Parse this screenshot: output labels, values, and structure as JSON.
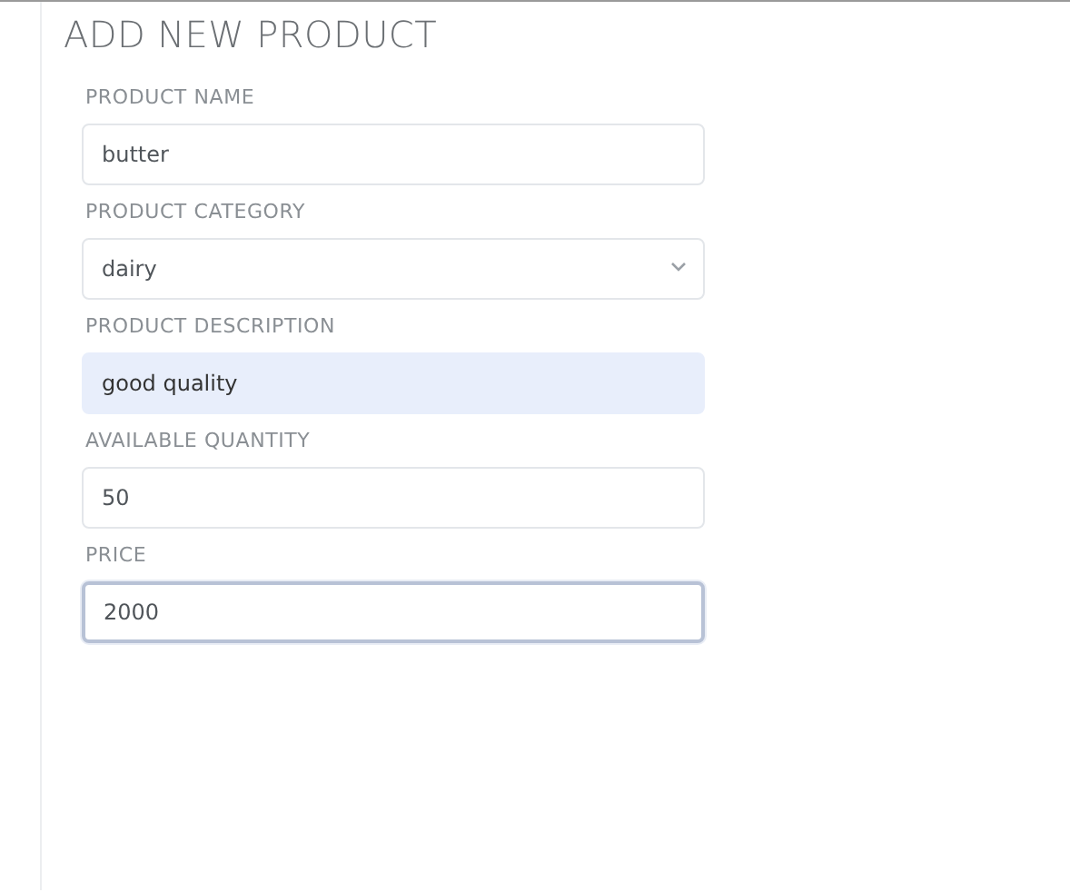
{
  "form": {
    "title": "ADD NEW PRODUCT",
    "fields": [
      {
        "label": "PRODUCT NAME",
        "kind": "text",
        "value": "butter",
        "autofilled": false,
        "focused": false
      },
      {
        "label": "PRODUCT CATEGORY",
        "kind": "select",
        "value": "dairy",
        "autofilled": false,
        "focused": false
      },
      {
        "label": "PRODUCT DESCRIPTION",
        "kind": "text",
        "value": "good quality",
        "autofilled": true,
        "focused": false
      },
      {
        "label": "AVAILABLE QUANTITY",
        "kind": "text",
        "value": "50",
        "autofilled": false,
        "focused": false
      },
      {
        "label": "PRICE",
        "kind": "text",
        "value": "2000",
        "autofilled": false,
        "focused": true
      }
    ]
  }
}
